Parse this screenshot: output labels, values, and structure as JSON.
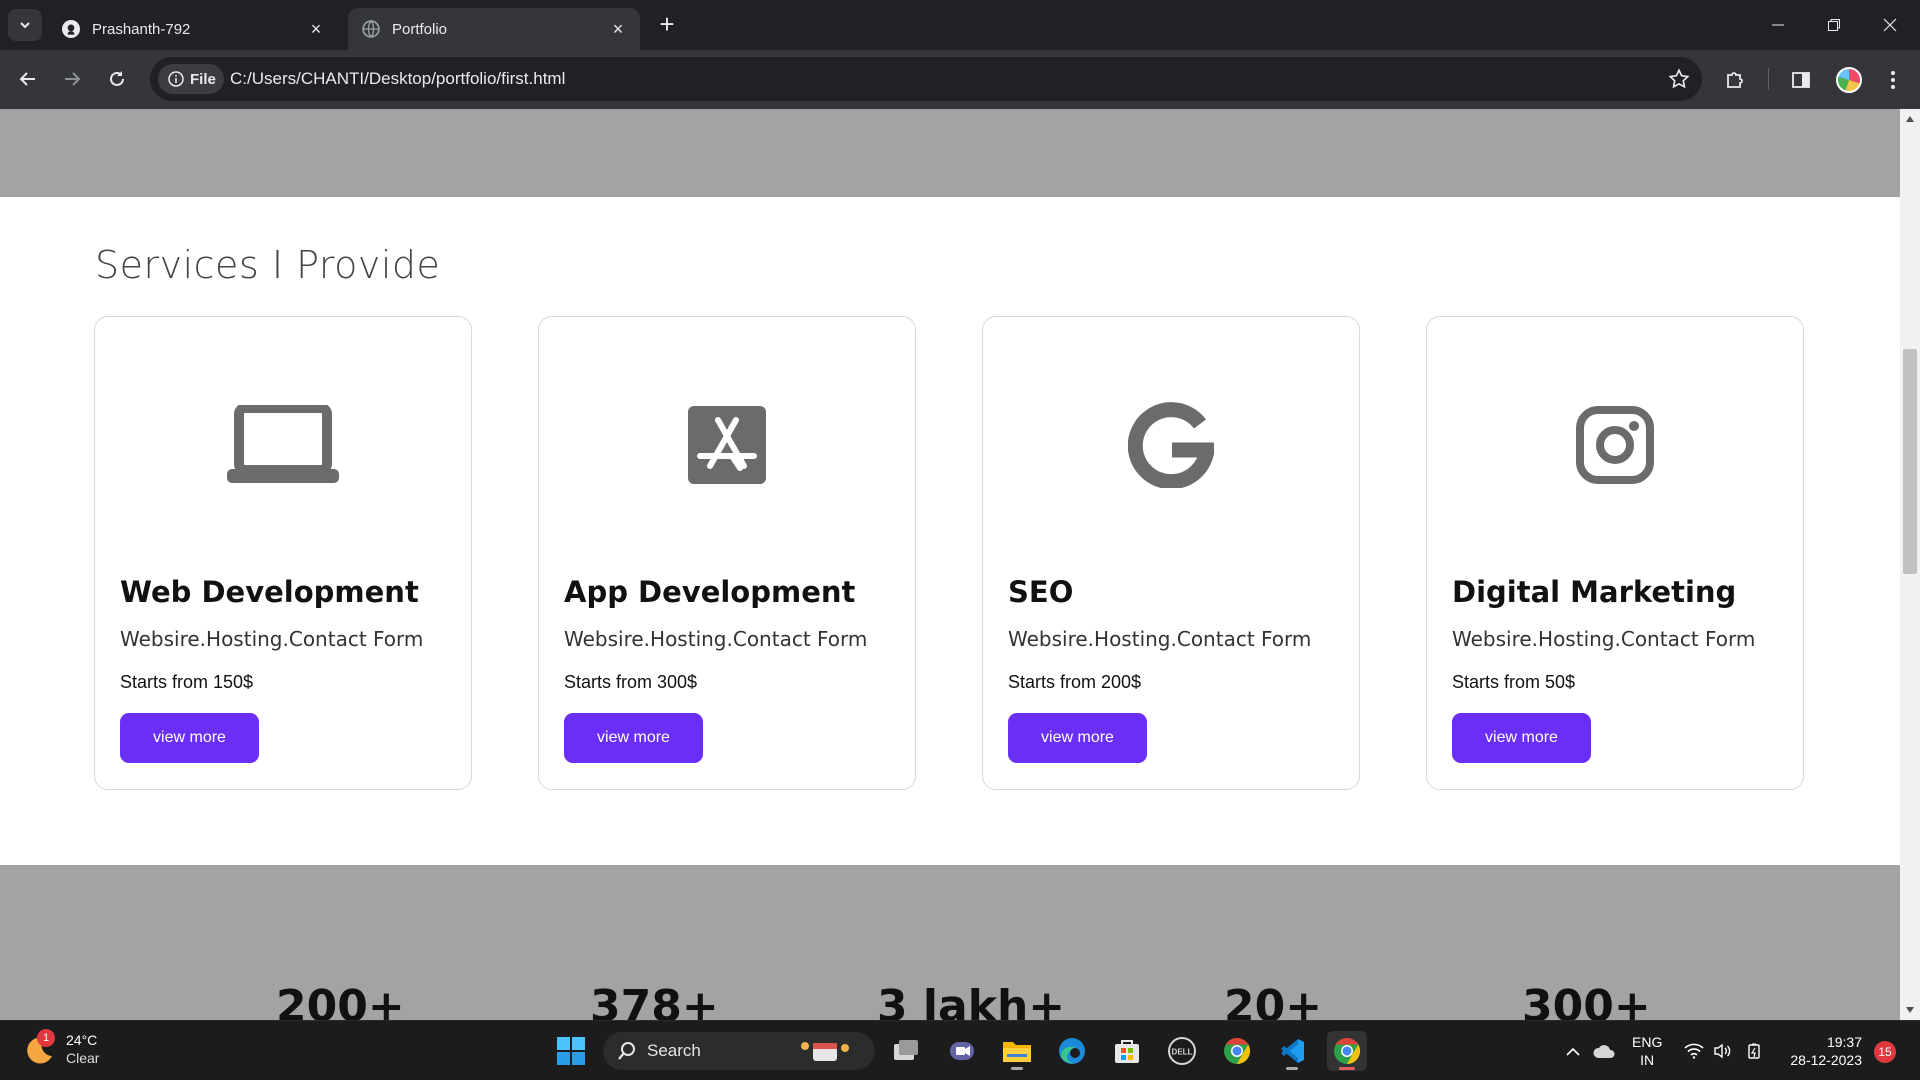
{
  "browser": {
    "tabs": [
      {
        "label": "Prashanth-792",
        "active": false,
        "icon": "github-icon"
      },
      {
        "label": "Portfolio",
        "active": true,
        "icon": "globe-icon"
      }
    ],
    "address": {
      "scheme_label": "File",
      "url": "C:/Users/CHANTI/Desktop/portfolio/first.html"
    }
  },
  "page": {
    "services_title": "Services I Provide",
    "cards": [
      {
        "title": "Web Development",
        "desc": "Websire.Hosting.Contact Form",
        "price": "Starts from 150$",
        "button": "view more",
        "icon": "laptop-icon"
      },
      {
        "title": "App Development",
        "desc": "Websire.Hosting.Contact Form",
        "price": "Starts from 300$",
        "button": "view more",
        "icon": "app-store-icon"
      },
      {
        "title": "SEO",
        "desc": "Websire.Hosting.Contact Form",
        "price": "Starts from 200$",
        "button": "view more",
        "icon": "google-icon"
      },
      {
        "title": "Digital Marketing",
        "desc": "Websire.Hosting.Contact Form",
        "price": "Starts from 50$",
        "button": "view more",
        "icon": "instagram-icon"
      }
    ],
    "stats": [
      "200+",
      "378+",
      "3 lakh+",
      "20+",
      "300+"
    ]
  },
  "taskbar": {
    "weather": {
      "temp": "24°C",
      "condition": "Clear",
      "badge": "1"
    },
    "search_label": "Search",
    "language": {
      "line1": "ENG",
      "line2": "IN"
    },
    "clock": {
      "time": "19:37",
      "date": "28-12-2023"
    },
    "notifications": "15"
  },
  "colors": {
    "accent": "#6a2ef6",
    "band": "#a3a3a3",
    "icon_gray": "#6b6b6b"
  }
}
